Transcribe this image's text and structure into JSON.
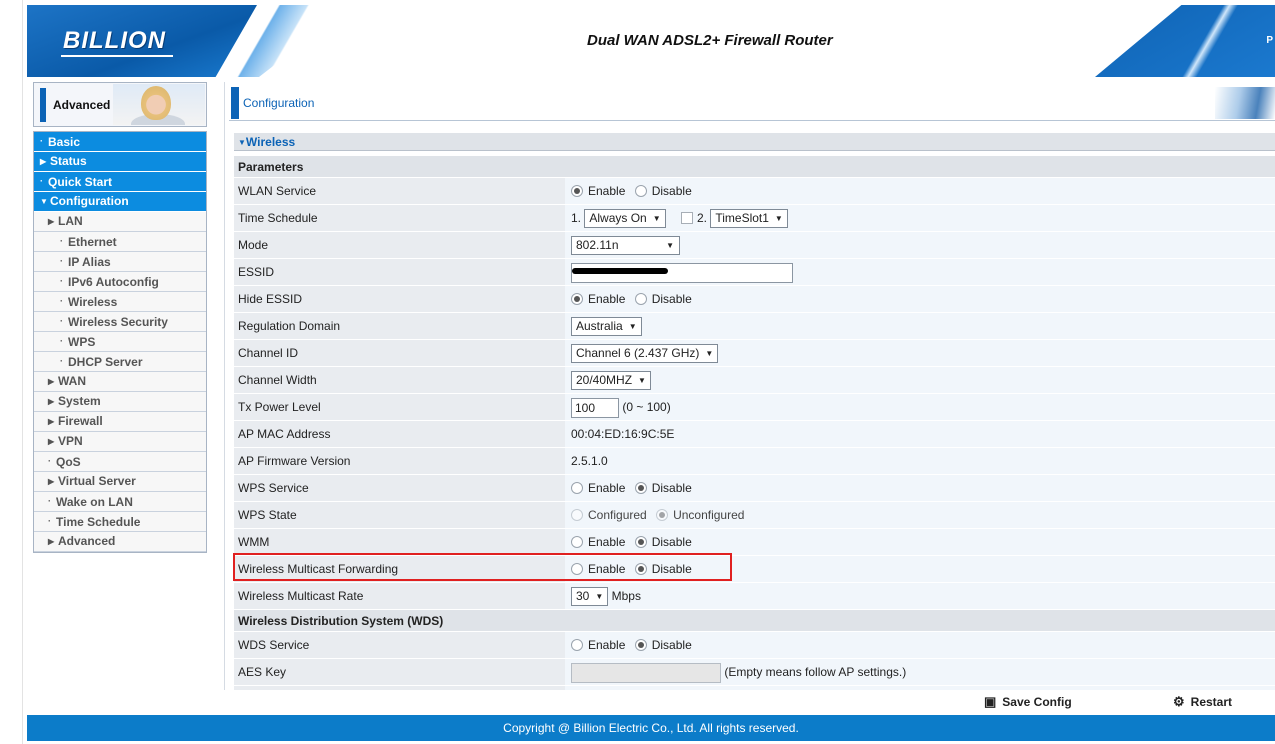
{
  "header": {
    "logo": "BILLION",
    "title": "Dual WAN ADSL2+ Firewall Router",
    "right_text": "P"
  },
  "sidebar": {
    "section_label": "Advanced",
    "items": [
      {
        "label": "Basic",
        "kind": "top",
        "marker": "dot"
      },
      {
        "label": "Status",
        "kind": "top",
        "marker": "arrow-right"
      },
      {
        "label": "Quick Start",
        "kind": "top",
        "marker": "dot"
      },
      {
        "label": "Configuration",
        "kind": "top",
        "marker": "arrow-down"
      },
      {
        "label": "LAN",
        "kind": "lvl1",
        "marker": "arrow-right"
      },
      {
        "label": "Ethernet",
        "kind": "lvl2",
        "marker": "dot"
      },
      {
        "label": "IP Alias",
        "kind": "lvl2",
        "marker": "dot"
      },
      {
        "label": "IPv6 Autoconfig",
        "kind": "lvl2",
        "marker": "dot"
      },
      {
        "label": "Wireless",
        "kind": "lvl2",
        "marker": "dot"
      },
      {
        "label": "Wireless Security",
        "kind": "lvl2",
        "marker": "dot"
      },
      {
        "label": "WPS",
        "kind": "lvl2",
        "marker": "dot"
      },
      {
        "label": "DHCP Server",
        "kind": "lvl2",
        "marker": "dot"
      },
      {
        "label": "WAN",
        "kind": "lvl1",
        "marker": "arrow-right"
      },
      {
        "label": "System",
        "kind": "lvl1",
        "marker": "arrow-right"
      },
      {
        "label": "Firewall",
        "kind": "lvl1",
        "marker": "arrow-right"
      },
      {
        "label": "VPN",
        "kind": "lvl1",
        "marker": "arrow-right"
      },
      {
        "label": "QoS",
        "kind": "lvl1",
        "marker": "dot"
      },
      {
        "label": "Virtual Server",
        "kind": "lvl1",
        "marker": "arrow-right"
      },
      {
        "label": "Wake on LAN",
        "kind": "lvl1",
        "marker": "dot"
      },
      {
        "label": "Time Schedule",
        "kind": "lvl1",
        "marker": "dot"
      },
      {
        "label": "Advanced",
        "kind": "lvl1",
        "marker": "arrow-right"
      }
    ]
  },
  "content": {
    "page_title": "Configuration",
    "section_title": "Wireless",
    "parameters_header": "Parameters",
    "wlan_service": {
      "label": "WLAN Service",
      "options": [
        "Enable",
        "Disable"
      ],
      "selected": "Enable"
    },
    "time_schedule": {
      "label": "Time Schedule",
      "prefix1": "1.",
      "value1": "Always On",
      "prefix2": "2.",
      "value2": "TimeSlot1"
    },
    "mode": {
      "label": "Mode",
      "value": "802.11n"
    },
    "essid": {
      "label": "ESSID",
      "value": ""
    },
    "hide_essid": {
      "label": "Hide ESSID",
      "options": [
        "Enable",
        "Disable"
      ],
      "selected": "Enable"
    },
    "regulation_domain": {
      "label": "Regulation Domain",
      "value": "Australia"
    },
    "channel_id": {
      "label": "Channel ID",
      "value": "Channel 6 (2.437 GHz)"
    },
    "channel_width": {
      "label": "Channel Width",
      "value": "20/40MHZ"
    },
    "tx_power": {
      "label": "Tx Power Level",
      "value": "100",
      "hint": "(0 ~ 100)"
    },
    "ap_mac": {
      "label": "AP MAC Address",
      "value": "00:04:ED:16:9C:5E"
    },
    "ap_firmware": {
      "label": "AP Firmware Version",
      "value": "2.5.1.0"
    },
    "wps_service": {
      "label": "WPS Service",
      "options": [
        "Enable",
        "Disable"
      ],
      "selected": "Disable"
    },
    "wps_state": {
      "label": "WPS State",
      "options": [
        "Configured",
        "Unconfigured"
      ],
      "selected": "Unconfigured"
    },
    "wmm": {
      "label": "WMM",
      "options": [
        "Enable",
        "Disable"
      ],
      "selected": "Disable"
    },
    "multicast_forwarding": {
      "label": "Wireless Multicast Forwarding",
      "options": [
        "Enable",
        "Disable"
      ],
      "selected": "Disable"
    },
    "multicast_rate": {
      "label": "Wireless Multicast Rate",
      "value": "30",
      "unit": "Mbps"
    },
    "wds_header": "Wireless Distribution System (WDS)",
    "wds_service": {
      "label": "WDS Service",
      "options": [
        "Enable",
        "Disable"
      ],
      "selected": "Disable"
    },
    "aes_key": {
      "label": "AES Key",
      "value": "",
      "hint": "(Empty means follow AP settings.)"
    }
  },
  "toolbar": {
    "save_label": "Save Config",
    "restart_label": "Restart"
  },
  "footer": {
    "copyright": "Copyright @ Billion Electric Co., Ltd. All rights reserved."
  }
}
